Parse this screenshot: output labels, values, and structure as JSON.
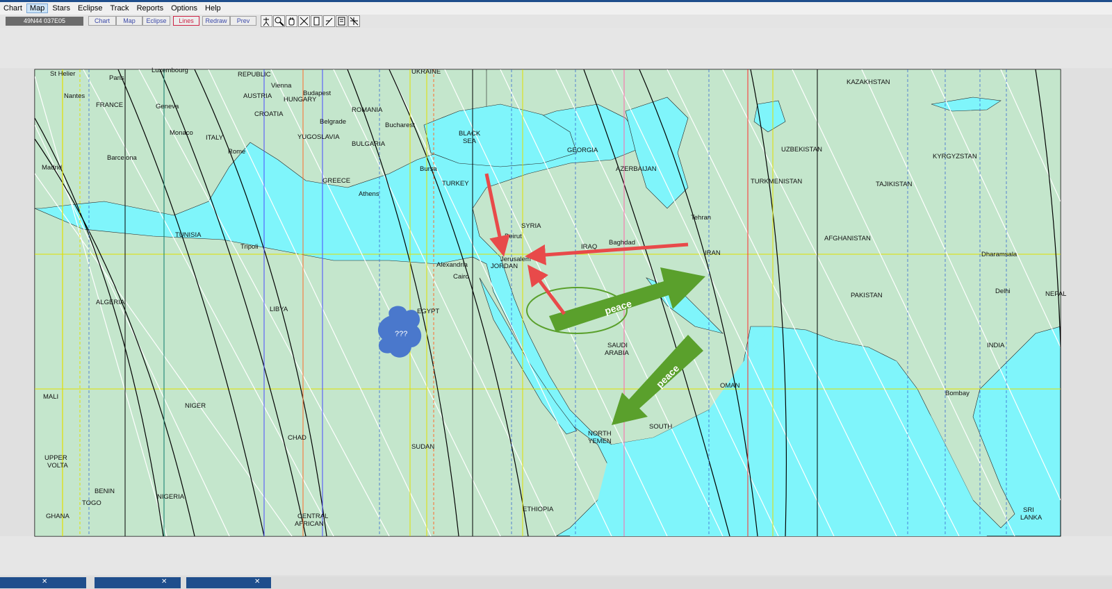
{
  "menu": {
    "items": [
      {
        "label": "Chart"
      },
      {
        "label": "Map"
      },
      {
        "label": "Stars"
      },
      {
        "label": "Eclipse"
      },
      {
        "label": "Track"
      },
      {
        "label": "Reports"
      },
      {
        "label": "Options"
      },
      {
        "label": "Help"
      }
    ],
    "active_index": 1
  },
  "toolbar": {
    "coordinates": "49N44  037E05",
    "buttons": [
      {
        "label": "Chart"
      },
      {
        "label": "Map"
      },
      {
        "label": "Eclipse"
      },
      {
        "label": "Lines"
      },
      {
        "label": "Redraw"
      },
      {
        "label": "Prev"
      }
    ],
    "pressed_index": 3
  },
  "map": {
    "land_color": "#c4e6cc",
    "water_color": "#7ff5fb",
    "labels": [
      {
        "text": "St Helier"
      },
      {
        "text": "Paris"
      },
      {
        "text": "Luxembourg"
      },
      {
        "text": "REPUBLIC"
      },
      {
        "text": "UKRAINE"
      },
      {
        "text": "Nantes"
      },
      {
        "text": "Vienna"
      },
      {
        "text": "Budapest"
      },
      {
        "text": "AUSTRIA"
      },
      {
        "text": "HUNGARY"
      },
      {
        "text": "FRANCE"
      },
      {
        "text": "Geneva"
      },
      {
        "text": "CROATIA"
      },
      {
        "text": "ROMANIA"
      },
      {
        "text": "Belgrade"
      },
      {
        "text": "Bucharest"
      },
      {
        "text": "Monaco"
      },
      {
        "text": "ITALY"
      },
      {
        "text": "YUGOSLAVIA"
      },
      {
        "text": "BLACK"
      },
      {
        "text": "SEA"
      },
      {
        "text": "BULGARIA"
      },
      {
        "text": "Rome"
      },
      {
        "text": "Barcelona"
      },
      {
        "text": "Madrid"
      },
      {
        "text": "GEORGIA"
      },
      {
        "text": "AZERBAIJAN"
      },
      {
        "text": "Bursa"
      },
      {
        "text": "TURKEY"
      },
      {
        "text": "GREECE"
      },
      {
        "text": "Athens"
      },
      {
        "text": "KAZAKHSTAN"
      },
      {
        "text": "UZBEKISTAN"
      },
      {
        "text": "KYRGYZSTAN"
      },
      {
        "text": "TURKMENISTAN"
      },
      {
        "text": "TAJIKISTAN"
      },
      {
        "text": "Tehran"
      },
      {
        "text": "TUNISIA"
      },
      {
        "text": "Tripoli"
      },
      {
        "text": "SYRIA"
      },
      {
        "text": "Beirut"
      },
      {
        "text": "Baghdad"
      },
      {
        "text": "IRAQ"
      },
      {
        "text": "AFGHANISTAN"
      },
      {
        "text": "Jerusalem"
      },
      {
        "text": "JORDAN"
      },
      {
        "text": "IRAN"
      },
      {
        "text": "Alexandria"
      },
      {
        "text": "Dharamsala"
      },
      {
        "text": "Cairo"
      },
      {
        "text": "Delhi"
      },
      {
        "text": "ALGERIA"
      },
      {
        "text": "LIBYA"
      },
      {
        "text": "EGYPT"
      },
      {
        "text": "PAKISTAN"
      },
      {
        "text": "NEPAL"
      },
      {
        "text": "SAUDI"
      },
      {
        "text": "ARABIA"
      },
      {
        "text": "INDIA"
      },
      {
        "text": "OMAN"
      },
      {
        "text": "MALI"
      },
      {
        "text": "Bombay"
      },
      {
        "text": "NIGER"
      },
      {
        "text": "NORTH"
      },
      {
        "text": "YEMEN"
      },
      {
        "text": "SOUTH"
      },
      {
        "text": "CHAD"
      },
      {
        "text": "SUDAN"
      },
      {
        "text": "UPPER"
      },
      {
        "text": "VOLTA"
      },
      {
        "text": "BENIN"
      },
      {
        "text": "TOGO"
      },
      {
        "text": "NIGERIA"
      },
      {
        "text": "ETHIOPIA"
      },
      {
        "text": "GHANA"
      },
      {
        "text": "CENTRAL"
      },
      {
        "text": "AFRICAN"
      },
      {
        "text": "SRI"
      },
      {
        "text": "LANKA"
      }
    ],
    "annotations": {
      "peace_1": "peace",
      "peace_2": "peace",
      "cloud_text": "???"
    },
    "annotation_colors": {
      "red_arrow": "#e84a4a",
      "green_arrow": "#5aa02c"
    }
  }
}
